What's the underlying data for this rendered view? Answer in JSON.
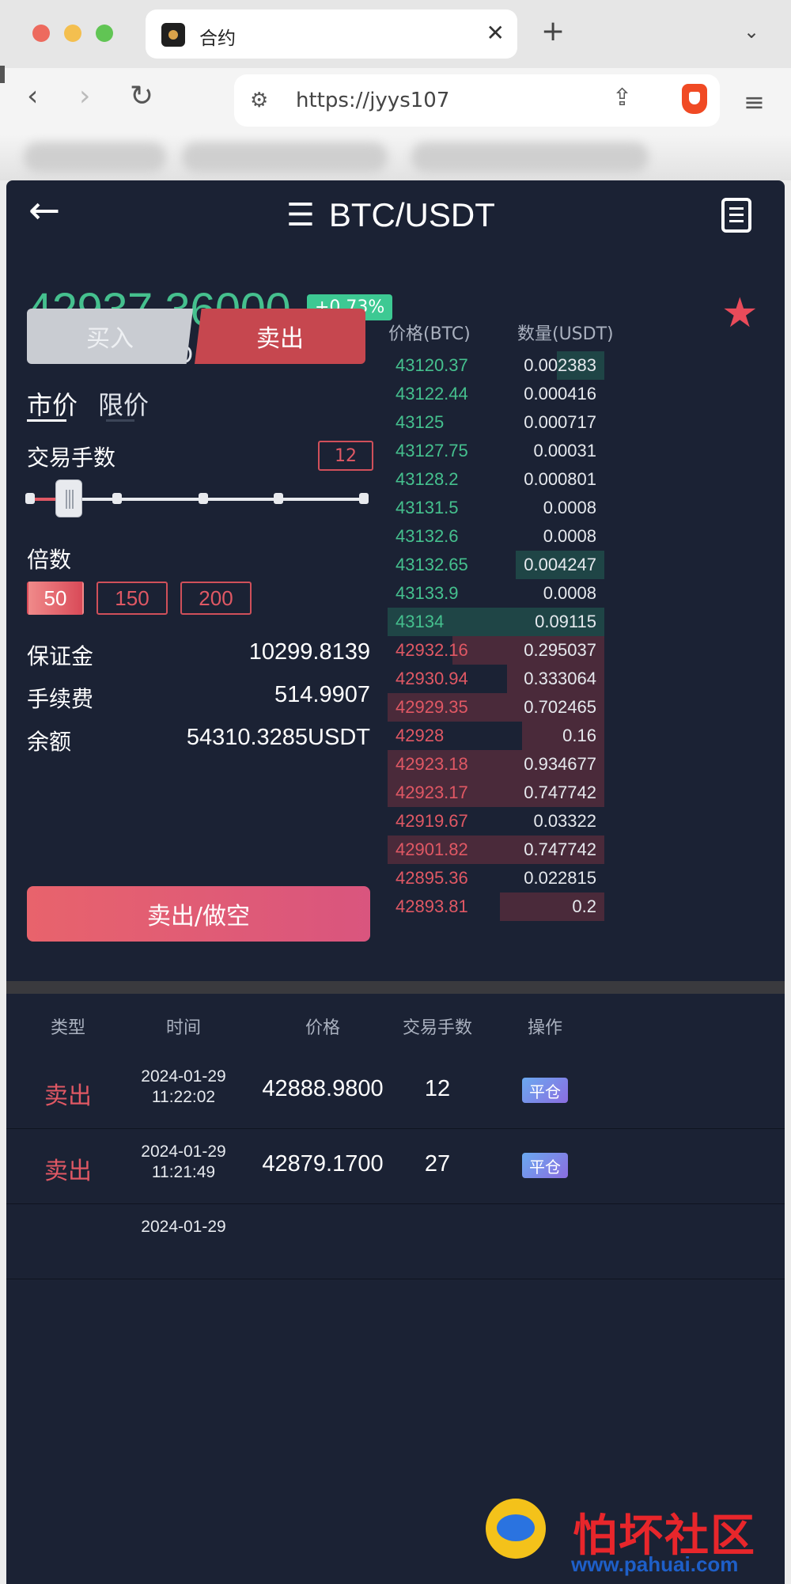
{
  "browser": {
    "tab_title": "合约",
    "tab_close": "✕",
    "new_tab": "+",
    "url": "https://jyys107"
  },
  "header": {
    "pair": "BTC/USDT"
  },
  "ticker": {
    "price": "42937.36000",
    "change": "+0.73%",
    "price_usd": "42937.36 USD"
  },
  "trade_form": {
    "buy_tab": "买入",
    "sell_tab": "卖出",
    "order_types": [
      "市价",
      "限价"
    ],
    "lots_label": "交易手数",
    "lots_value": "12",
    "slider_level": 0.12,
    "multiplier_label": "倍数",
    "multipliers": [
      "50",
      "150",
      "200"
    ],
    "active_multiplier": "50",
    "margin_label": "保证金",
    "margin_value": "10299.8139",
    "fee_label": "手续费",
    "fee_value": "514.9907",
    "balance_label": "余额",
    "balance_value": "54310.3285USDT",
    "submit_label": "卖出/做空"
  },
  "order_book": {
    "price_header": "价格(BTC)",
    "qty_header": "数量(USDT)",
    "asks": [
      {
        "price": "43120.37",
        "qty": "0.002383",
        "depth": 0.22
      },
      {
        "price": "43122.44",
        "qty": "0.000416",
        "depth": 0.0
      },
      {
        "price": "43125",
        "qty": "0.000717",
        "depth": 0.0
      },
      {
        "price": "43127.75",
        "qty": "0.00031",
        "depth": 0.0
      },
      {
        "price": "43128.2",
        "qty": "0.000801",
        "depth": 0.0
      },
      {
        "price": "43131.5",
        "qty": "0.0008",
        "depth": 0.0
      },
      {
        "price": "43132.6",
        "qty": "0.0008",
        "depth": 0.0
      },
      {
        "price": "43132.65",
        "qty": "0.004247",
        "depth": 0.41
      },
      {
        "price": "43133.9",
        "qty": "0.0008",
        "depth": 0.0
      },
      {
        "price": "43134",
        "qty": "0.09115",
        "depth": 1.0
      }
    ],
    "bids": [
      {
        "price": "42932.16",
        "qty": "0.295037",
        "depth": 0.7
      },
      {
        "price": "42930.94",
        "qty": "0.333064",
        "depth": 0.45
      },
      {
        "price": "42929.35",
        "qty": "0.702465",
        "depth": 1.0
      },
      {
        "price": "42928",
        "qty": "0.16",
        "depth": 0.38
      },
      {
        "price": "42923.18",
        "qty": "0.934677",
        "depth": 1.0
      },
      {
        "price": "42923.17",
        "qty": "0.747742",
        "depth": 1.0
      },
      {
        "price": "42919.67",
        "qty": "0.03322",
        "depth": 0.0
      },
      {
        "price": "42901.82",
        "qty": "0.747742",
        "depth": 1.0
      },
      {
        "price": "42895.36",
        "qty": "0.022815",
        "depth": 0.0
      },
      {
        "price": "42893.81",
        "qty": "0.2",
        "depth": 0.48
      }
    ]
  },
  "records": {
    "headers": [
      "类型",
      "时间",
      "价格",
      "交易手数",
      "操作"
    ],
    "rows": [
      {
        "type": "卖出",
        "date": "2024-01-29",
        "time": "11:22:02",
        "price": "42888.9800",
        "lots": "12",
        "action": "平仓"
      },
      {
        "type": "卖出",
        "date": "2024-01-29",
        "time": "11:21:49",
        "price": "42879.1700",
        "lots": "27",
        "action": "平仓"
      },
      {
        "type": "",
        "date": "2024-01-29",
        "time": "",
        "price": "",
        "lots": "",
        "action": ""
      }
    ]
  },
  "watermark": {
    "text": "怕坏社区",
    "url": "www.pahuai.com"
  },
  "colors": {
    "background": "#1b2234",
    "ask_green": "#45c08e",
    "bid_red": "#e05864",
    "ask_bar": "#1f4546",
    "bid_bar": "#4a2a3a"
  }
}
